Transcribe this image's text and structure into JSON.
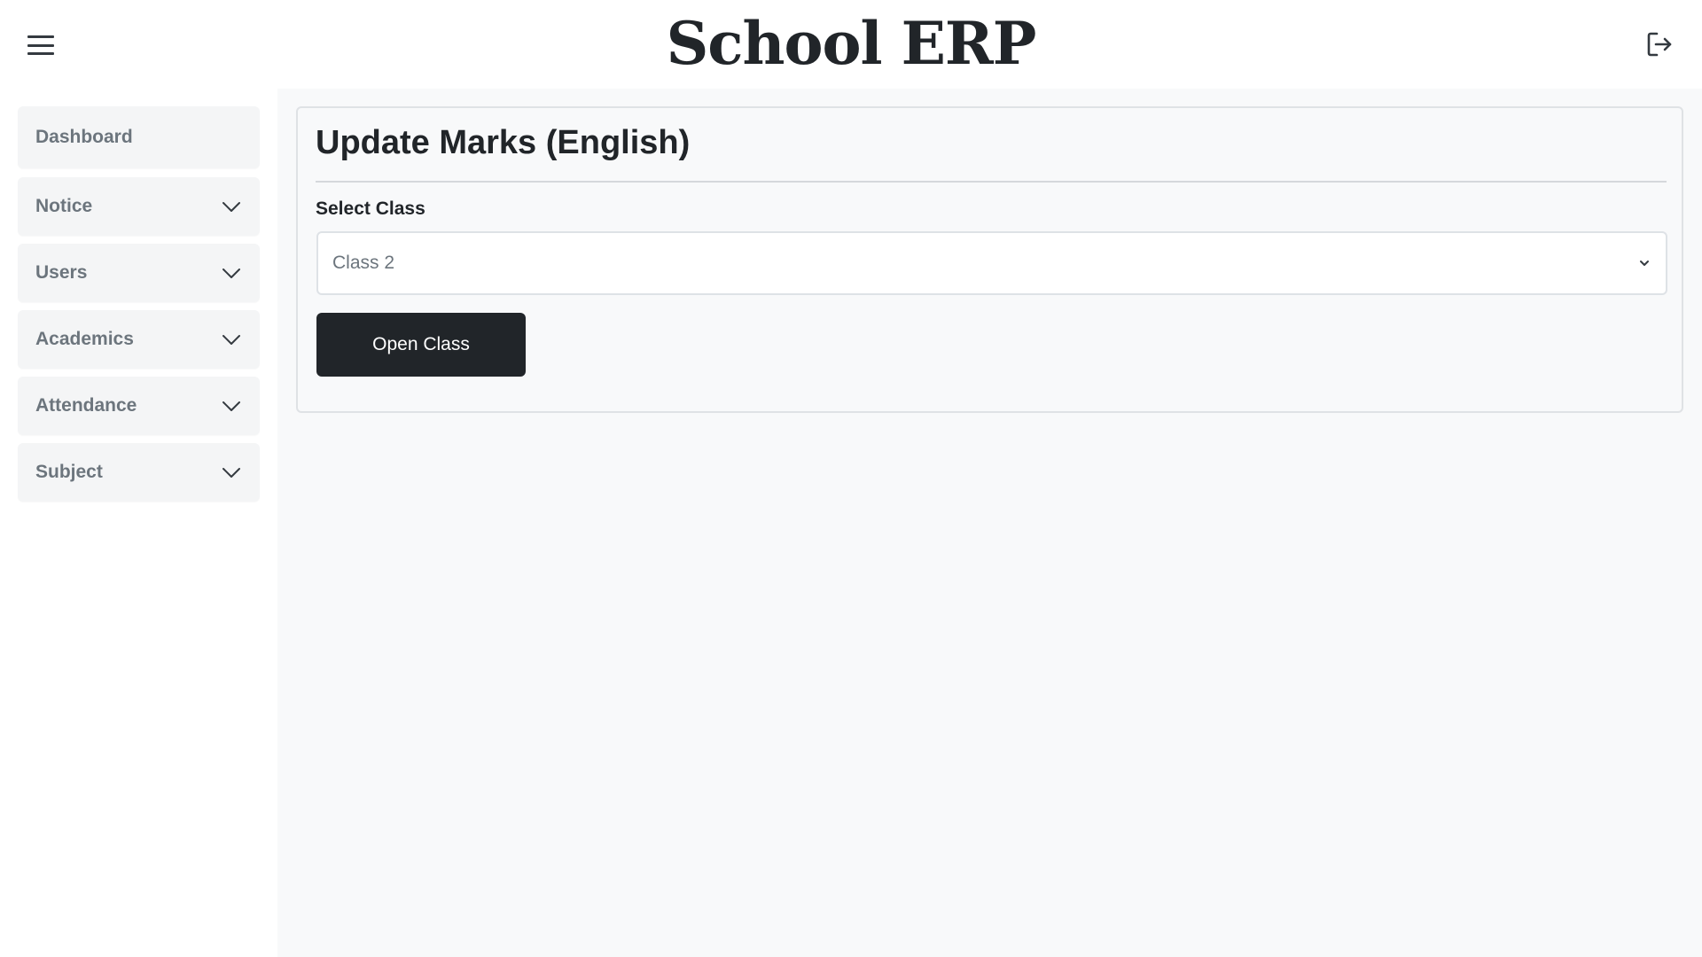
{
  "header": {
    "title": "School ERP",
    "menu_icon": "hamburger-menu-icon",
    "logout_icon": "logout-icon"
  },
  "sidebar": {
    "items": [
      {
        "label": "Dashboard",
        "expandable": false
      },
      {
        "label": "Notice",
        "expandable": true
      },
      {
        "label": "Users",
        "expandable": true
      },
      {
        "label": "Academics",
        "expandable": true
      },
      {
        "label": "Attendance",
        "expandable": true
      },
      {
        "label": "Subject",
        "expandable": true
      }
    ]
  },
  "main": {
    "title": "Update Marks (English)",
    "select_label": "Select Class",
    "select_value": "Class 2",
    "button_label": "Open Class"
  },
  "colors": {
    "primary_dark": "#212529",
    "muted_text": "#6c757d",
    "content_bg": "#f8f9fa",
    "sidebar_item_bg": "#f4f5f6"
  }
}
